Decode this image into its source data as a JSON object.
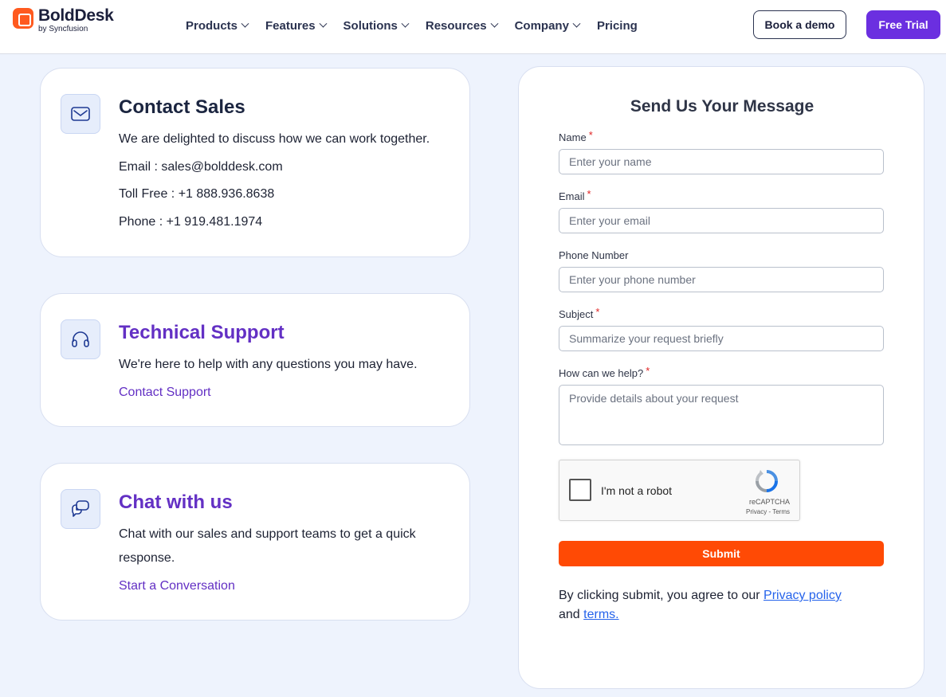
{
  "header": {
    "logo": {
      "name": "BoldDesk",
      "sub": "by Syncfusion"
    },
    "nav": [
      "Products",
      "Features",
      "Solutions",
      "Resources",
      "Company",
      "Pricing"
    ],
    "book_demo": "Book a demo",
    "free_trial": "Free Trial"
  },
  "contact_sales": {
    "title": "Contact Sales",
    "description": "We are delighted to discuss how we can work together.",
    "email": "Email : sales@bolddesk.com",
    "toll_free": "Toll Free : +1 888.936.8638",
    "phone": "Phone : +1 919.481.1974"
  },
  "technical_support": {
    "title": "Technical Support",
    "description": "We're here to help with any questions you may have.",
    "link": "Contact Support"
  },
  "chat": {
    "title": "Chat with us",
    "description_line1": "Chat with our sales and support teams to get a quick",
    "description_line2": "response.",
    "link": "Start a Conversation"
  },
  "form": {
    "title": "Send Us Your Message",
    "name": {
      "label": "Name",
      "placeholder": "Enter your name",
      "required": "*"
    },
    "email": {
      "label": "Email",
      "placeholder": "Enter your email",
      "required": "*"
    },
    "phone": {
      "label": "Phone Number",
      "placeholder": "Enter your phone number"
    },
    "subject": {
      "label": "Subject",
      "placeholder": "Summarize your request briefly",
      "required": "*"
    },
    "help": {
      "label": "How can we help?",
      "placeholder": "Provide details about your request",
      "required": "*"
    },
    "captcha": {
      "label": "I'm not a robot",
      "brand": "reCAPTCHA",
      "links": "Privacy - Terms"
    },
    "submit": "Submit",
    "consent_prefix": "By clicking submit, you agree to our",
    "privacy_link": "Privacy policy",
    "consent_and": "and",
    "terms_link": "terms."
  },
  "colors": {
    "accent_purple": "#6b2fe0",
    "submit_orange": "#ff4a05",
    "link_blue": "#2563eb",
    "page_bg": "#eef3fd"
  }
}
